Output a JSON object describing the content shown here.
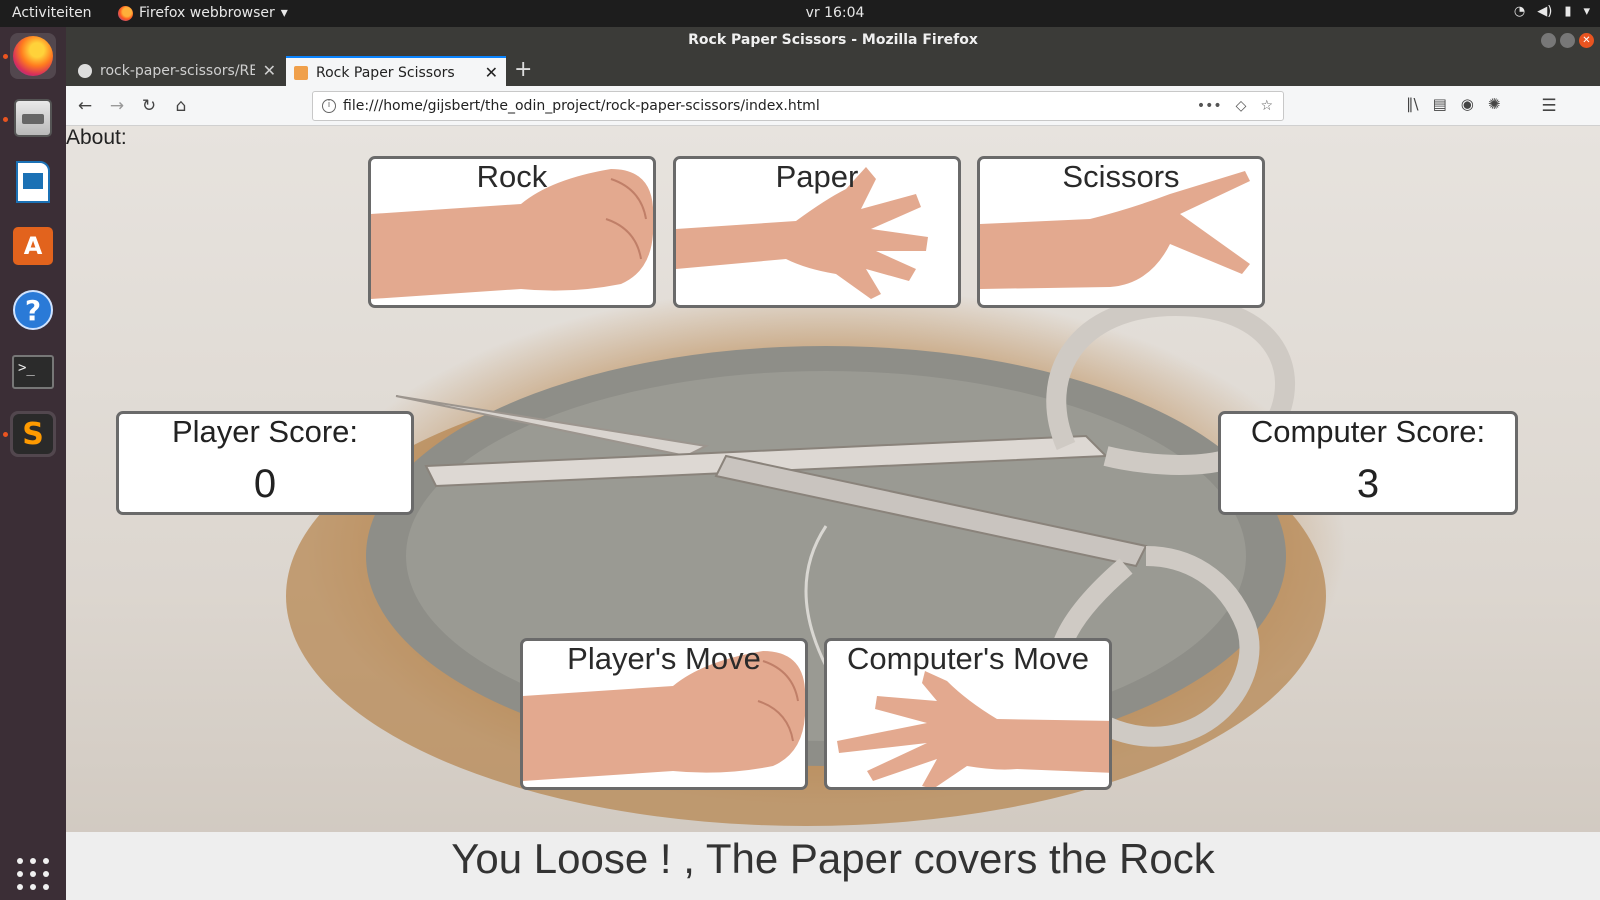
{
  "topbar": {
    "activities": "Activiteiten",
    "app_name": "Firefox webbrowser",
    "clock": "vr 16:04"
  },
  "window": {
    "title": "Rock Paper Scissors - Mozilla Firefox"
  },
  "tabs": [
    {
      "label": "rock-paper-scissors/REA"
    },
    {
      "label": "Rock Paper Scissors"
    }
  ],
  "navbar": {
    "url": "file:///home/gijsbert/the_odin_project/rock-paper-scissors/index.html"
  },
  "page": {
    "about": "About:",
    "choices": {
      "rock": "Rock",
      "paper": "Paper",
      "scissors": "Scissors"
    },
    "player_score": {
      "title": "Player Score:",
      "value": "0"
    },
    "computer_score": {
      "title": "Computer Score:",
      "value": "3"
    },
    "moves": {
      "player": "Player's Move",
      "computer": "Computer's Move"
    },
    "result": "You Loose ! , The Paper covers the Rock"
  },
  "colors": {
    "accent": "#e95420",
    "tab_highlight": "#0a84ff",
    "card_border": "#6a6a6a",
    "skin": "#e3a98f"
  }
}
